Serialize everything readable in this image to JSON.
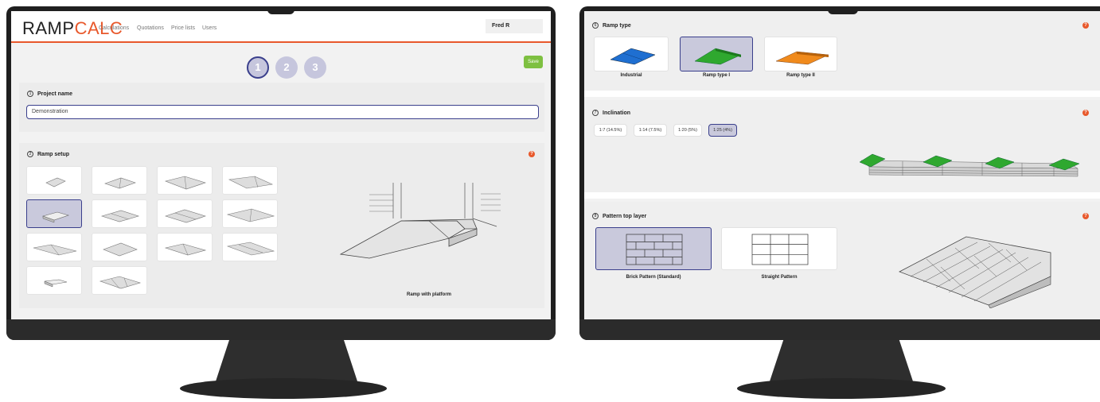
{
  "left": {
    "logo_main": "RAMP",
    "logo_accent": "CALC",
    "nav": [
      "Calculations",
      "Quotations",
      "Price lists",
      "Users"
    ],
    "user": "Fred R",
    "steps": [
      "1",
      "2",
      "3"
    ],
    "save_label": "Save",
    "project": {
      "number": "1",
      "title": "Project name",
      "value": "Demonstration"
    },
    "setup": {
      "number": "2",
      "title": "Ramp setup",
      "help": "?",
      "caption": "Ramp with platform"
    }
  },
  "right": {
    "ramp_type": {
      "number": "6",
      "title": "Ramp type",
      "help": "?",
      "options": [
        "Industrial",
        "Ramp type I",
        "Ramp type II"
      ]
    },
    "inclination": {
      "number": "7",
      "title": "Inclination",
      "help": "?",
      "options": [
        "1:7 (14.5%)",
        "1:14 (7.5%)",
        "1:20 (5%)",
        "1:25 (4%)"
      ]
    },
    "pattern": {
      "number": "8",
      "title": "Pattern top layer",
      "help": "?",
      "options": [
        "Brick Pattern (Standard)",
        "Straight Pattern"
      ]
    }
  },
  "colors": {
    "accent": "#e8582b",
    "selected": "#c9c9dc",
    "selected_border": "#3a3f8c",
    "save": "#7ec041",
    "industrial": "#1f6fd1",
    "type1": "#2fa82f",
    "type2": "#f08a1c"
  }
}
